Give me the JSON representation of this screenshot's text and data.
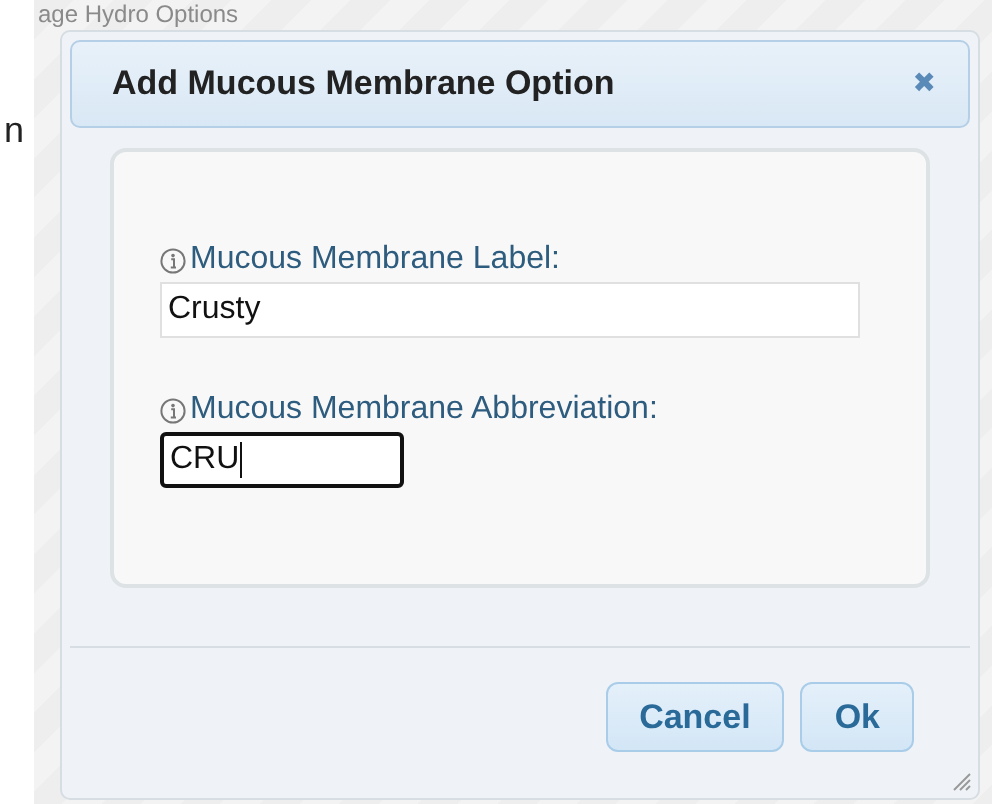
{
  "background": {
    "heading": "age Hydro Options",
    "side_text": "n"
  },
  "dialog": {
    "title": "Add Mucous Membrane Option",
    "close": "✖",
    "fields": [
      {
        "label": "Mucous Membrane Label:",
        "value": "Crusty",
        "focused": false,
        "wide": true
      },
      {
        "label": "Mucous Membrane Abbreviation:",
        "value": "CRU",
        "focused": true,
        "wide": false
      }
    ],
    "buttons": [
      "Cancel",
      "Ok"
    ]
  }
}
